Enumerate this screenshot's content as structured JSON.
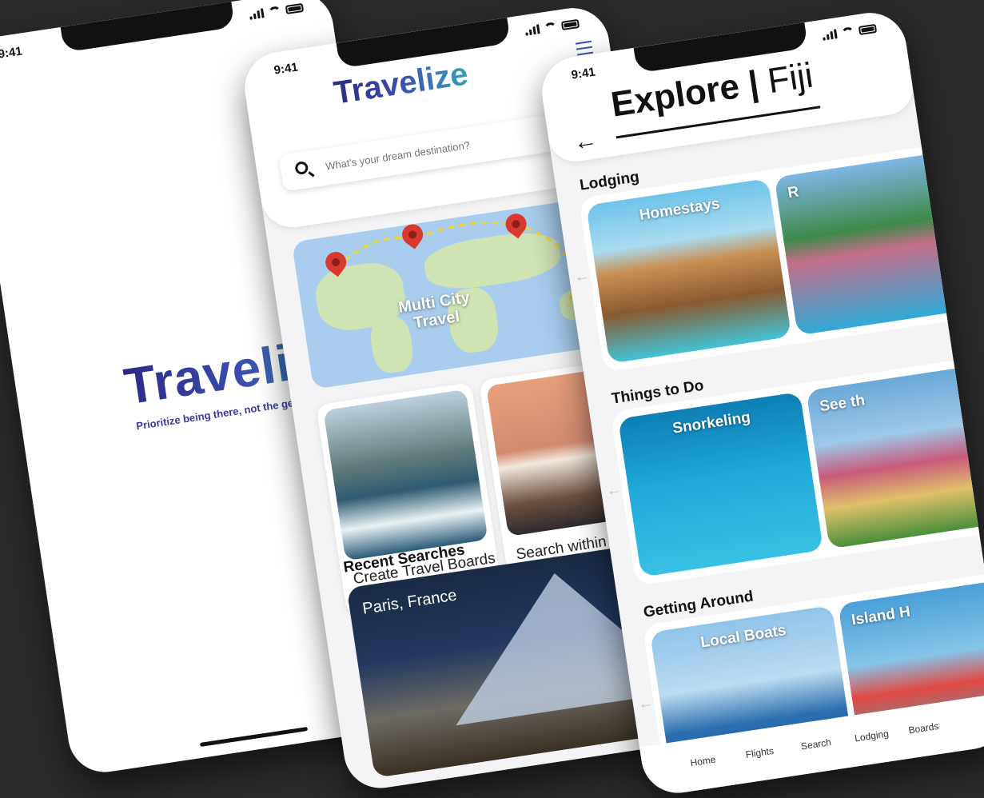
{
  "status": {
    "time": "9:41"
  },
  "splash": {
    "logo": "Travelize",
    "tagline": "Prioritize being there, not the getting there"
  },
  "home": {
    "logo": "Travelize",
    "search_placeholder": "What's your dream destination?",
    "map_label": "Multi City Travel",
    "tiles": [
      {
        "label": "Create Travel Boards"
      },
      {
        "label": "Search within a Date Range"
      }
    ],
    "recent_title": "Recent Searches",
    "recent": [
      {
        "label": "Paris, France"
      }
    ]
  },
  "explore": {
    "title_bold": "Explore",
    "separator": "|",
    "title_place": "Fiji",
    "sections": [
      {
        "title": "Lodging",
        "cards": [
          "Homestays",
          "R"
        ]
      },
      {
        "title": "Things to Do",
        "cards": [
          "Snorkeling",
          "See th"
        ]
      },
      {
        "title": "Getting Around",
        "cards": [
          "Local Boats",
          "Island H"
        ]
      }
    ],
    "tabs": [
      "Home",
      "Flights",
      "Search",
      "Lodging",
      "Boards"
    ]
  },
  "colors": {
    "background": "#2b2b2d",
    "brand_navy": "#2d2a87",
    "brand_teal": "#3aa0b8",
    "pin": "#d9392f"
  }
}
